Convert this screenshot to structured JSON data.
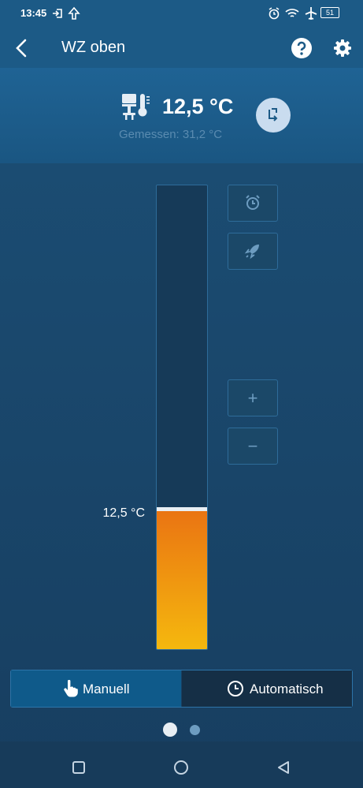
{
  "status_bar": {
    "time": "13:45",
    "battery": "51",
    "left_icons": [
      "sign-in-icon",
      "upload-arrow-icon"
    ],
    "right_icons": [
      "alarm-icon",
      "wifi-icon",
      "airplane-icon",
      "battery-icon"
    ]
  },
  "app_bar": {
    "title": "WZ oben",
    "back_icon": "back-chevron-icon",
    "help_icon": "help-icon",
    "settings_icon": "gear-icon"
  },
  "header": {
    "setpoint": "12,5 °C",
    "measured": "Gemessen: 31,2 °C",
    "device_icon": "thermostat-device-icon",
    "swap_icon": "swap-icon"
  },
  "thermostat": {
    "current_label": "12,5 °C",
    "level_fraction": 0.3,
    "side_buttons": {
      "timer_icon": "alarm-clock-icon",
      "boost_icon": "rocket-icon",
      "plus_label": "+",
      "minus_label": "−"
    }
  },
  "mode": {
    "manual_label": "Manuell",
    "auto_label": "Automatisch",
    "selected": "manual"
  },
  "pager": {
    "pages": 2,
    "current": 1
  },
  "nav": {
    "buttons": [
      "recent-apps-icon",
      "home-icon",
      "back-triangle-icon"
    ]
  },
  "colors": {
    "accent": "#1c5a86",
    "fill_top": "#ea7412",
    "fill_bottom": "#f5b80e"
  }
}
